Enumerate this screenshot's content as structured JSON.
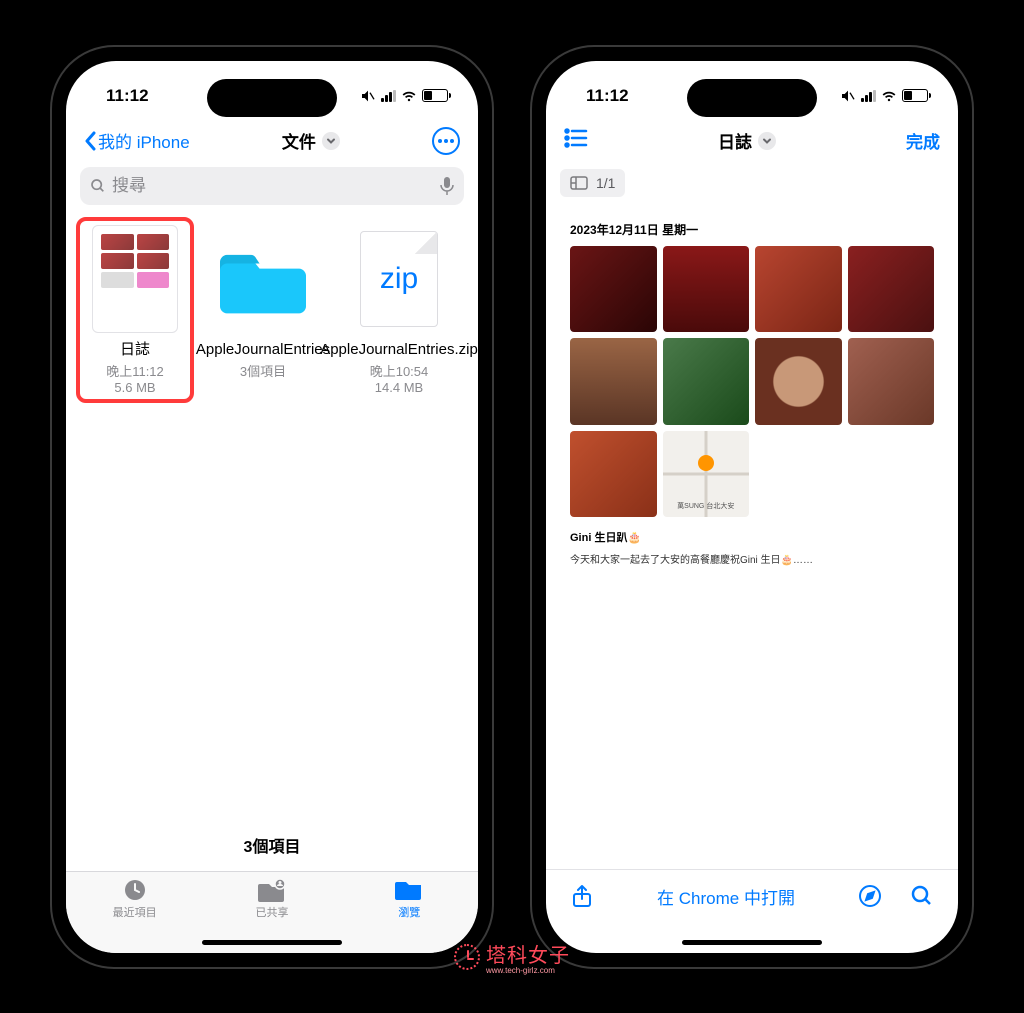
{
  "status": {
    "time": "11:12"
  },
  "left": {
    "back_label": "我的 iPhone",
    "title": "文件",
    "search_placeholder": "搜尋",
    "files": [
      {
        "name": "日誌",
        "meta": "晚上11:12",
        "size": "5.6 MB"
      },
      {
        "name": "AppleJournalEntries",
        "meta": "3個項目",
        "size": ""
      },
      {
        "name": "AppleJournalEntries.zip",
        "meta": "晚上10:54",
        "size": "14.4 MB"
      }
    ],
    "items_summary": "3個項目",
    "tabs": {
      "recent": "最近項目",
      "shared": "已共享",
      "browse": "瀏覽"
    }
  },
  "right": {
    "title": "日誌",
    "done": "完成",
    "page_indicator": "1/1",
    "journal": {
      "date": "2023年12月11日 星期一",
      "map_label": "萬SUNG 台北大安",
      "entry_title": "Gini 生日趴🎂",
      "entry_body": "今天和大家一起去了大安的高餐廳慶祝Gini 生日🎂……"
    },
    "open_in_chrome": "在 Chrome 中打開"
  },
  "watermark": {
    "text": "塔科女子",
    "sub": "www.tech-girlz.com"
  }
}
